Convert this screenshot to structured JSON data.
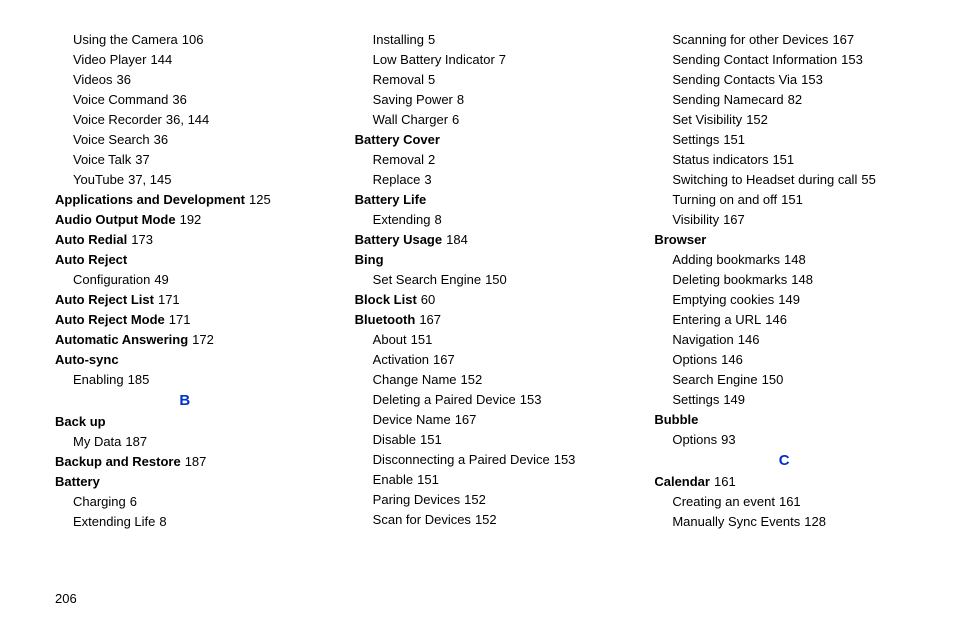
{
  "pageNumber": "206",
  "columns": [
    [
      {
        "type": "entry",
        "label": "Using the Camera",
        "pages": "106",
        "bold": false,
        "sub": true
      },
      {
        "type": "entry",
        "label": "Video Player",
        "pages": "144",
        "bold": false,
        "sub": true
      },
      {
        "type": "entry",
        "label": "Videos",
        "pages": "36",
        "bold": false,
        "sub": true
      },
      {
        "type": "entry",
        "label": "Voice Command",
        "pages": "36",
        "bold": false,
        "sub": true
      },
      {
        "type": "entry",
        "label": "Voice Recorder",
        "pages": "36, 144",
        "bold": false,
        "sub": true
      },
      {
        "type": "entry",
        "label": "Voice Search",
        "pages": "36",
        "bold": false,
        "sub": true
      },
      {
        "type": "entry",
        "label": "Voice Talk",
        "pages": "37",
        "bold": false,
        "sub": true
      },
      {
        "type": "entry",
        "label": "YouTube",
        "pages": "37, 145",
        "bold": false,
        "sub": true
      },
      {
        "type": "entry",
        "label": "Applications and Development",
        "pages": "125",
        "bold": true,
        "sub": false
      },
      {
        "type": "entry",
        "label": "Audio Output Mode",
        "pages": "192",
        "bold": true,
        "sub": false
      },
      {
        "type": "entry",
        "label": "Auto Redial",
        "pages": "173",
        "bold": true,
        "sub": false
      },
      {
        "type": "entry",
        "label": "Auto Reject",
        "pages": "",
        "bold": true,
        "sub": false
      },
      {
        "type": "entry",
        "label": "Configuration",
        "pages": "49",
        "bold": false,
        "sub": true
      },
      {
        "type": "entry",
        "label": "Auto Reject List",
        "pages": "171",
        "bold": true,
        "sub": false
      },
      {
        "type": "entry",
        "label": "Auto Reject Mode",
        "pages": "171",
        "bold": true,
        "sub": false
      },
      {
        "type": "entry",
        "label": "Automatic Answering",
        "pages": "172",
        "bold": true,
        "sub": false
      },
      {
        "type": "entry",
        "label": "Auto-sync",
        "pages": "",
        "bold": true,
        "sub": false
      },
      {
        "type": "entry",
        "label": "Enabling",
        "pages": "185",
        "bold": false,
        "sub": true
      },
      {
        "type": "letter",
        "label": "B"
      },
      {
        "type": "entry",
        "label": "Back up",
        "pages": "",
        "bold": true,
        "sub": false
      },
      {
        "type": "entry",
        "label": "My Data",
        "pages": "187",
        "bold": false,
        "sub": true
      },
      {
        "type": "entry",
        "label": "Backup and Restore",
        "pages": "187",
        "bold": true,
        "sub": false
      },
      {
        "type": "entry",
        "label": "Battery",
        "pages": "",
        "bold": true,
        "sub": false
      },
      {
        "type": "entry",
        "label": "Charging",
        "pages": "6",
        "bold": false,
        "sub": true
      },
      {
        "type": "entry",
        "label": "Extending Life",
        "pages": "8",
        "bold": false,
        "sub": true
      }
    ],
    [
      {
        "type": "entry",
        "label": "Installing",
        "pages": "5",
        "bold": false,
        "sub": true
      },
      {
        "type": "entry",
        "label": "Low Battery Indicator",
        "pages": "7",
        "bold": false,
        "sub": true
      },
      {
        "type": "entry",
        "label": "Removal",
        "pages": "5",
        "bold": false,
        "sub": true
      },
      {
        "type": "entry",
        "label": "Saving Power",
        "pages": "8",
        "bold": false,
        "sub": true
      },
      {
        "type": "entry",
        "label": "Wall Charger",
        "pages": "6",
        "bold": false,
        "sub": true
      },
      {
        "type": "entry",
        "label": "Battery Cover",
        "pages": "",
        "bold": true,
        "sub": false
      },
      {
        "type": "entry",
        "label": "Removal",
        "pages": "2",
        "bold": false,
        "sub": true
      },
      {
        "type": "entry",
        "label": "Replace",
        "pages": "3",
        "bold": false,
        "sub": true
      },
      {
        "type": "entry",
        "label": "Battery Life",
        "pages": "",
        "bold": true,
        "sub": false
      },
      {
        "type": "entry",
        "label": "Extending",
        "pages": "8",
        "bold": false,
        "sub": true
      },
      {
        "type": "entry",
        "label": "Battery Usage",
        "pages": "184",
        "bold": true,
        "sub": false
      },
      {
        "type": "entry",
        "label": "Bing",
        "pages": "",
        "bold": true,
        "sub": false
      },
      {
        "type": "entry",
        "label": "Set Search Engine",
        "pages": "150",
        "bold": false,
        "sub": true
      },
      {
        "type": "entry",
        "label": "Block List",
        "pages": "60",
        "bold": true,
        "sub": false
      },
      {
        "type": "entry",
        "label": "Bluetooth",
        "pages": "167",
        "bold": true,
        "sub": false
      },
      {
        "type": "entry",
        "label": "About",
        "pages": "151",
        "bold": false,
        "sub": true
      },
      {
        "type": "entry",
        "label": "Activation",
        "pages": "167",
        "bold": false,
        "sub": true
      },
      {
        "type": "entry",
        "label": "Change Name",
        "pages": "152",
        "bold": false,
        "sub": true
      },
      {
        "type": "entry",
        "label": "Deleting a Paired Device",
        "pages": "153",
        "bold": false,
        "sub": true
      },
      {
        "type": "entry",
        "label": "Device Name",
        "pages": "167",
        "bold": false,
        "sub": true
      },
      {
        "type": "entry",
        "label": "Disable",
        "pages": "151",
        "bold": false,
        "sub": true
      },
      {
        "type": "entry",
        "label": "Disconnecting a Paired Device",
        "pages": "153",
        "bold": false,
        "sub": true
      },
      {
        "type": "entry",
        "label": "Enable",
        "pages": "151",
        "bold": false,
        "sub": true
      },
      {
        "type": "entry",
        "label": "Paring Devices",
        "pages": "152",
        "bold": false,
        "sub": true
      },
      {
        "type": "entry",
        "label": "Scan for Devices",
        "pages": "152",
        "bold": false,
        "sub": true
      }
    ],
    [
      {
        "type": "entry",
        "label": "Scanning for other Devices",
        "pages": "167",
        "bold": false,
        "sub": true
      },
      {
        "type": "entry",
        "label": "Sending Contact Information",
        "pages": "153",
        "bold": false,
        "sub": true
      },
      {
        "type": "entry",
        "label": "Sending Contacts Via",
        "pages": "153",
        "bold": false,
        "sub": true
      },
      {
        "type": "entry",
        "label": "Sending Namecard",
        "pages": "82",
        "bold": false,
        "sub": true
      },
      {
        "type": "entry",
        "label": "Set Visibility",
        "pages": "152",
        "bold": false,
        "sub": true
      },
      {
        "type": "entry",
        "label": "Settings",
        "pages": "151",
        "bold": false,
        "sub": true
      },
      {
        "type": "entry",
        "label": "Status indicators",
        "pages": "151",
        "bold": false,
        "sub": true
      },
      {
        "type": "entry",
        "label": "Switching to Headset during call",
        "pages": "55",
        "bold": false,
        "sub": true
      },
      {
        "type": "entry",
        "label": "Turning on and off",
        "pages": "151",
        "bold": false,
        "sub": true
      },
      {
        "type": "entry",
        "label": "Visibility",
        "pages": "167",
        "bold": false,
        "sub": true
      },
      {
        "type": "entry",
        "label": "Browser",
        "pages": "",
        "bold": true,
        "sub": false
      },
      {
        "type": "entry",
        "label": "Adding bookmarks",
        "pages": "148",
        "bold": false,
        "sub": true
      },
      {
        "type": "entry",
        "label": "Deleting bookmarks",
        "pages": "148",
        "bold": false,
        "sub": true
      },
      {
        "type": "entry",
        "label": "Emptying cookies",
        "pages": "149",
        "bold": false,
        "sub": true
      },
      {
        "type": "entry",
        "label": "Entering a URL",
        "pages": "146",
        "bold": false,
        "sub": true
      },
      {
        "type": "entry",
        "label": "Navigation",
        "pages": "146",
        "bold": false,
        "sub": true
      },
      {
        "type": "entry",
        "label": "Options",
        "pages": "146",
        "bold": false,
        "sub": true
      },
      {
        "type": "entry",
        "label": "Search Engine",
        "pages": "150",
        "bold": false,
        "sub": true
      },
      {
        "type": "entry",
        "label": "Settings",
        "pages": "149",
        "bold": false,
        "sub": true
      },
      {
        "type": "entry",
        "label": "Bubble",
        "pages": "",
        "bold": true,
        "sub": false
      },
      {
        "type": "entry",
        "label": "Options",
        "pages": "93",
        "bold": false,
        "sub": true
      },
      {
        "type": "letter",
        "label": "C"
      },
      {
        "type": "entry",
        "label": "Calendar",
        "pages": "161",
        "bold": true,
        "sub": false
      },
      {
        "type": "entry",
        "label": "Creating an event",
        "pages": "161",
        "bold": false,
        "sub": true
      },
      {
        "type": "entry",
        "label": "Manually Sync Events",
        "pages": "128",
        "bold": false,
        "sub": true
      }
    ]
  ]
}
